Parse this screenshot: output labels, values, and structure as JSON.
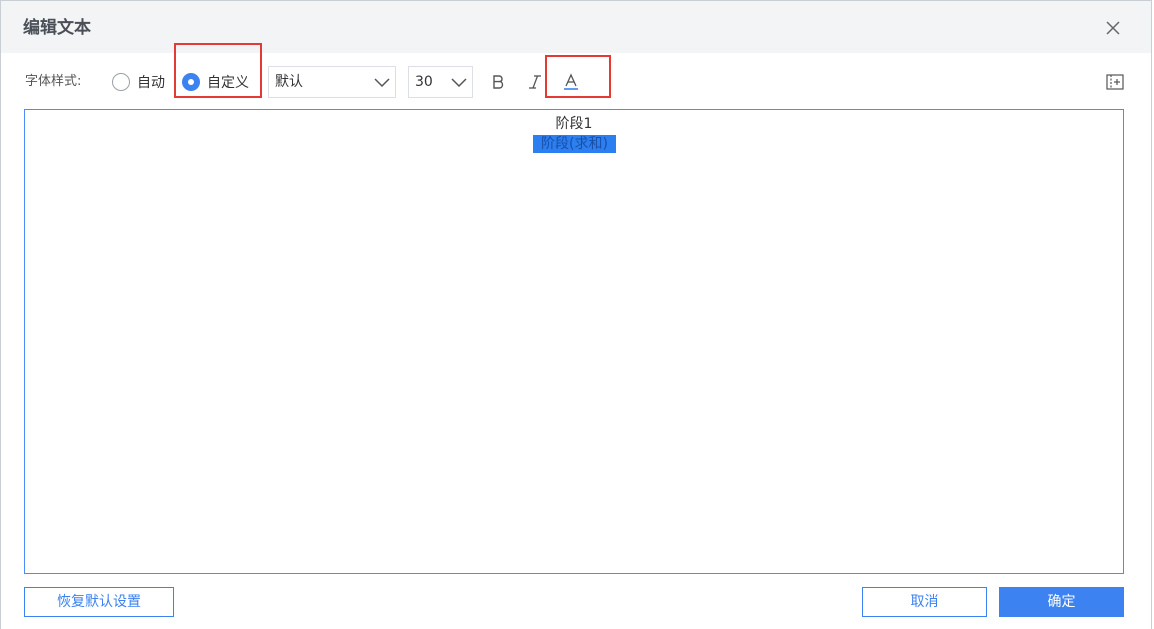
{
  "dialog": {
    "title": "编辑文本"
  },
  "toolbar": {
    "font_style_label": "字体样式:",
    "radio_auto": {
      "label": "自动",
      "checked": false
    },
    "radio_custom": {
      "label": "自定义",
      "checked": true
    },
    "font_family": {
      "value": "默认"
    },
    "font_size": {
      "value": "30"
    },
    "bold_icon": "bold-icon",
    "italic_icon": "italic-icon",
    "font_color_icon": "font-color-icon",
    "expand_icon": "insert-field-icon"
  },
  "editor": {
    "line1": "阶段1",
    "line2": "阶段(求和)"
  },
  "footer": {
    "reset_label": "恢复默认设置",
    "cancel_label": "取消",
    "ok_label": "确定"
  },
  "colors": {
    "accent": "#3c82f0",
    "highlight": "#e53935",
    "header_bg": "#f3f4f6",
    "selection": "#2b7ff0"
  }
}
